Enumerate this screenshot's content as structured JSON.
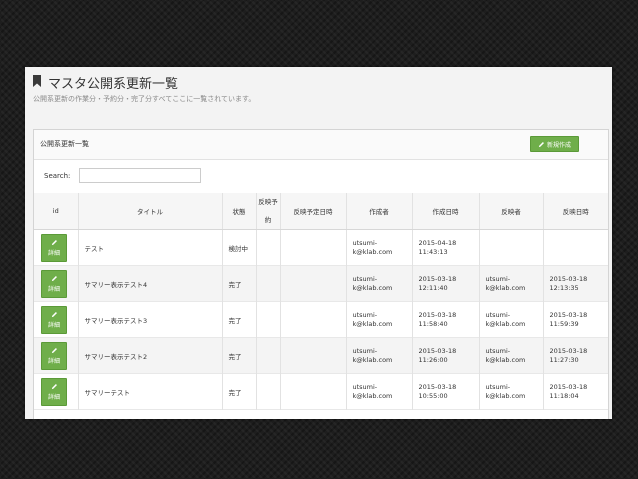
{
  "header": {
    "title": "マスタ公開系更新一覧",
    "subtitle": "公開系更新の作業分・予約分・完了分すべてここに一覧されています。"
  },
  "panel": {
    "title": "公開系更新一覧",
    "new_button_label": "新規作成"
  },
  "search": {
    "label": "Search:",
    "value": "",
    "placeholder": ""
  },
  "table": {
    "columns": [
      "id",
      "タイトル",
      "状態",
      "反映予約",
      "反映予定日時",
      "作成者",
      "作成日時",
      "反映者",
      "反映日時"
    ],
    "column_header_lines": {
      "col3": [
        "反映予",
        "約"
      ]
    },
    "detail_button_label": "詳細",
    "rows": [
      {
        "title": "テスト",
        "status": "検討中",
        "reserved": "",
        "scheduled": "",
        "creator": [
          "utsumi-",
          "k@klab.com"
        ],
        "created": [
          "2015-04-18",
          "11:43:13"
        ],
        "applier": [
          "",
          ""
        ],
        "applied": [
          "",
          ""
        ]
      },
      {
        "title": "サマリー表示テスト4",
        "status": "完了",
        "reserved": "",
        "scheduled": "",
        "creator": [
          "utsumi-",
          "k@klab.com"
        ],
        "created": [
          "2015-03-18",
          "12:11:40"
        ],
        "applier": [
          "utsumi-",
          "k@klab.com"
        ],
        "applied": [
          "2015-03-18",
          "12:13:35"
        ]
      },
      {
        "title": "サマリー表示テスト3",
        "status": "完了",
        "reserved": "",
        "scheduled": "",
        "creator": [
          "utsumi-",
          "k@klab.com"
        ],
        "created": [
          "2015-03-18",
          "11:58:40"
        ],
        "applier": [
          "utsumi-",
          "k@klab.com"
        ],
        "applied": [
          "2015-03-18",
          "11:59:39"
        ]
      },
      {
        "title": "サマリー表示テスト2",
        "status": "完了",
        "reserved": "",
        "scheduled": "",
        "creator": [
          "utsumi-",
          "k@klab.com"
        ],
        "created": [
          "2015-03-18",
          "11:26:00"
        ],
        "applier": [
          "utsumi-",
          "k@klab.com"
        ],
        "applied": [
          "2015-03-18",
          "11:27:30"
        ]
      },
      {
        "title": "サマリーテスト",
        "status": "完了",
        "reserved": "",
        "scheduled": "",
        "creator": [
          "utsumi-",
          "k@klab.com"
        ],
        "created": [
          "2015-03-18",
          "10:55:00"
        ],
        "applier": [
          "utsumi-",
          "k@klab.com"
        ],
        "applied": [
          "2015-03-18",
          "11:18:04"
        ]
      }
    ]
  },
  "colors": {
    "accent_green": "#6fae4a",
    "background": "#1e1e1e"
  }
}
